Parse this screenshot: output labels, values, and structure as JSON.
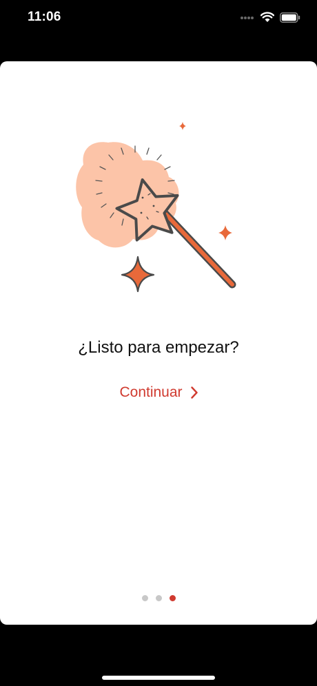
{
  "status_bar": {
    "time": "11:06",
    "icons": [
      "signal-icon",
      "wifi-icon",
      "battery-icon"
    ]
  },
  "onboarding": {
    "title": "¿Listo para empezar?",
    "continue_label": "Continuar",
    "page_indicator": {
      "total": 3,
      "current": 3
    }
  },
  "colors": {
    "accent": "#d03a2f",
    "illustration_orange": "#e8693a",
    "illustration_blob": "#fcc4a8",
    "outline": "#4a4a4a"
  },
  "illustration": {
    "name": "magic-wand-icon"
  }
}
